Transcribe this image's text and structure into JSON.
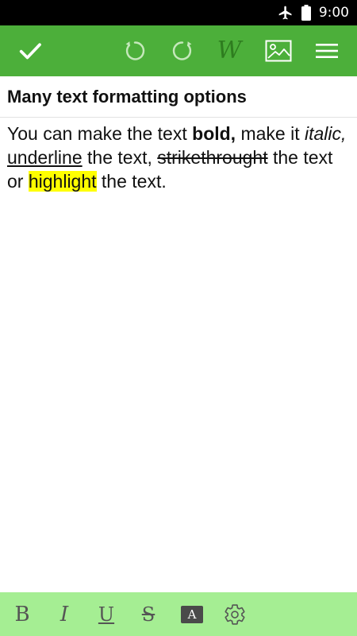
{
  "status_bar": {
    "time": "9:00",
    "icons": [
      "airplane-mode-icon",
      "battery-icon"
    ]
  },
  "toolbar": {
    "buttons": [
      "check-icon",
      "undo-icon",
      "redo-icon",
      "wikipedia-icon",
      "image-icon",
      "menu-icon"
    ],
    "wiki_label": "W"
  },
  "note": {
    "title": "Many text formatting options",
    "body": {
      "t1": "You can make the text ",
      "bold": "bold,",
      "t2": " make it ",
      "italic": "italic,",
      "t3": " ",
      "underline": "underline",
      "t4": " the text, ",
      "strike": "strikethrought",
      "t5": " the text or ",
      "highlight": "highlight",
      "t6": " the text."
    },
    "highlight_color": "#ffff00"
  },
  "format_bar": {
    "bold": "B",
    "italic": "I",
    "underline": "U",
    "strike": "S",
    "text_color": "A",
    "icons": [
      "text-color-icon",
      "settings-gear-icon"
    ]
  },
  "colors": {
    "toolbar": "#4caf3a",
    "format_bar": "#a5ee93",
    "status_bar": "#000000"
  }
}
